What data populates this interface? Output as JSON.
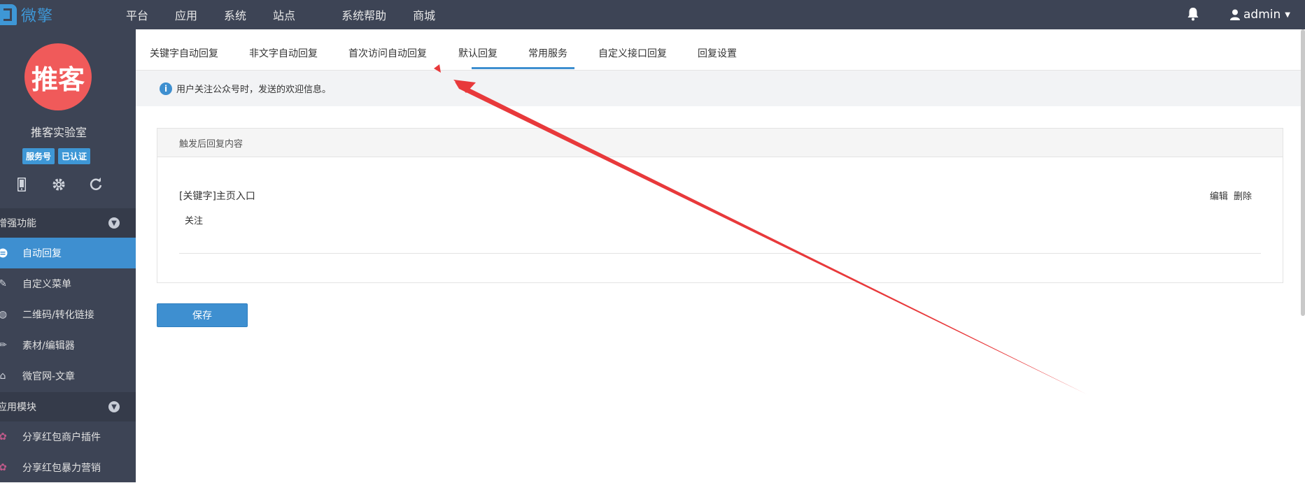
{
  "brand": {
    "logo_text": "微擎"
  },
  "topnav": {
    "items": [
      "平台",
      "应用",
      "系统",
      "站点",
      "系统帮助",
      "商城"
    ]
  },
  "user": {
    "name": "admin"
  },
  "sidebar": {
    "avatar_text": "推客",
    "account_name": "推客实验室",
    "badges": [
      "服务号",
      "已认证"
    ],
    "sections": [
      {
        "title": "增强功能",
        "items": [
          "自动回复",
          "自定义菜单",
          "二维码/转化链接",
          "素材/编辑器",
          "微官网-文章"
        ]
      },
      {
        "title": "应用模块",
        "items": [
          "分享红包商户插件",
          "分享红包暴力营销"
        ]
      }
    ]
  },
  "tabs": [
    "关键字自动回复",
    "非文字自动回复",
    "首次访问自动回复",
    "默认回复",
    "常用服务",
    "自定义接口回复",
    "回复设置"
  ],
  "info": {
    "text": "用户关注公众号时，发送的欢迎信息。"
  },
  "panel": {
    "title": "触发后回复内容",
    "rule_title": "[关键字]主页入口",
    "keyword": "关注",
    "edit_label": "编辑",
    "delete_label": "删除"
  },
  "save_label": "保存",
  "colors": {
    "topbar": "#3d4455",
    "accent": "#3e8fd0",
    "annotation": "#e8393b"
  }
}
